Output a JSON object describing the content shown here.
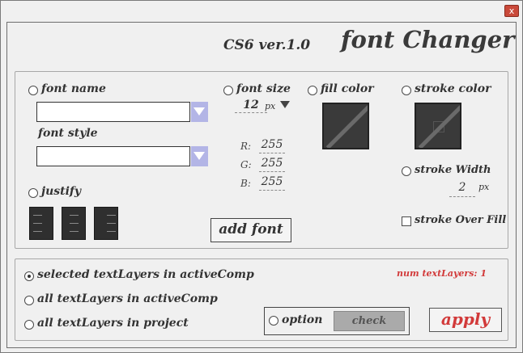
{
  "window": {
    "close_label": "x"
  },
  "header": {
    "version": "CS6  ver.1.0",
    "title": "font Changer"
  },
  "font": {
    "name_label": "font name",
    "name_value": "",
    "style_label": "font style",
    "style_value": "",
    "justify_label": "justify",
    "size_label": "font size",
    "size_value": "12",
    "size_unit": "px",
    "add_font_label": "add font"
  },
  "fill": {
    "label": "fill color",
    "r_label": "R:",
    "r_value": "255",
    "g_label": "G:",
    "g_value": "255",
    "b_label": "B:",
    "b_value": "255"
  },
  "stroke": {
    "color_label": "stroke color",
    "width_label": "stroke Width",
    "width_value": "2",
    "width_unit": "px",
    "over_fill_label": "stroke Over Fill"
  },
  "target": {
    "selected_label": "selected textLayers in activeComp",
    "selected_checked": true,
    "all_comp_label": "all textLayers in activeComp",
    "all_project_label": "all textLayers in project",
    "num_layers": "num textLayers: 1"
  },
  "footer": {
    "option_label": "option",
    "check_label": "check",
    "apply_label": "apply"
  },
  "colors": {
    "accent_red": "#d23a3a",
    "combo_arrow": "#b3b5e6",
    "swatch_bg": "#3a3a3a"
  },
  "icons": {
    "justify": [
      "justify-left-icon",
      "justify-center-icon",
      "justify-right-icon"
    ],
    "dropdown": "triangle-down-icon"
  }
}
